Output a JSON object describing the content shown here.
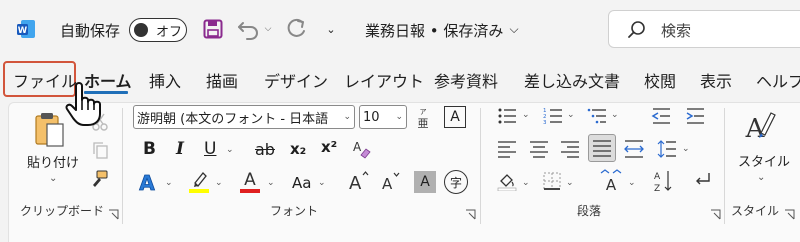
{
  "titlebar": {
    "app_icon": "word-app-icon",
    "autosave_label": "自動保存",
    "autosave_state": "オフ",
    "doc_title": "業務日報 • 保存済み",
    "search_placeholder": "検索"
  },
  "tabs": [
    "ファイル",
    "ホーム",
    "挿入",
    "描画",
    "デザイン",
    "レイアウト",
    "参考資料",
    "差し込み文書",
    "校閲",
    "表示",
    "ヘルプ"
  ],
  "active_tab": "ホーム",
  "ribbon": {
    "clipboard": {
      "paste_label": "貼り付け",
      "group_label": "クリップボード"
    },
    "font": {
      "font_name": "游明朝 (本文のフォント - 日本語",
      "font_size": "10",
      "bold": "B",
      "italic": "I",
      "underline": "U",
      "strike": "ab",
      "sub": "x₂",
      "sup": "x²",
      "change_case": "Aa",
      "grow": "A",
      "shrink": "A",
      "char_shade": "A",
      "phonetic": "字",
      "font_color": "A",
      "effects": "A",
      "group_label": "フォント",
      "highlight_color": "#ffff00",
      "font_color_value": "#e02020"
    },
    "paragraph": {
      "group_label": "段落"
    },
    "styles": {
      "styles_label": "スタイル",
      "group_label": "スタイル"
    }
  },
  "colors": {
    "accent_blue": "#1f6fb8",
    "file_highlight": "#d2553b",
    "word_blue": "#185abd"
  }
}
